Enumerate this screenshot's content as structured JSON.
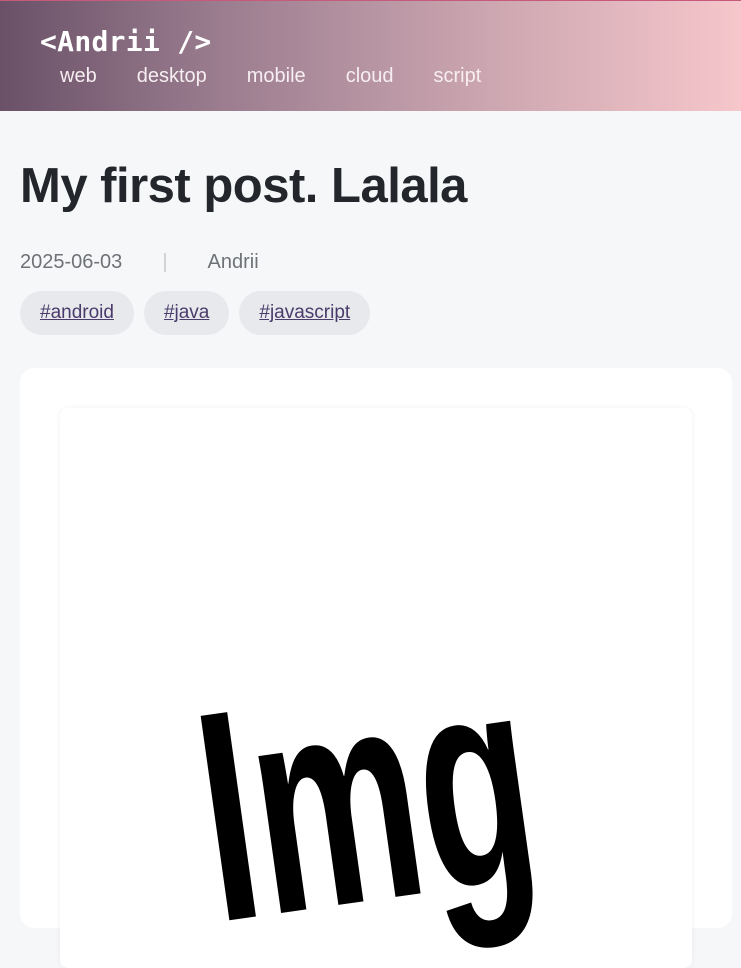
{
  "header": {
    "logo": "<Andrii />",
    "nav": [
      "web",
      "desktop",
      "mobile",
      "cloud",
      "script"
    ]
  },
  "post": {
    "title": "My first post. Lalala",
    "date": "2025-06-03",
    "separator": "|",
    "author": "Andrii",
    "tags": [
      "#android",
      "#java",
      "#javascript"
    ],
    "image": {
      "logo_text": "Img"
    }
  }
}
